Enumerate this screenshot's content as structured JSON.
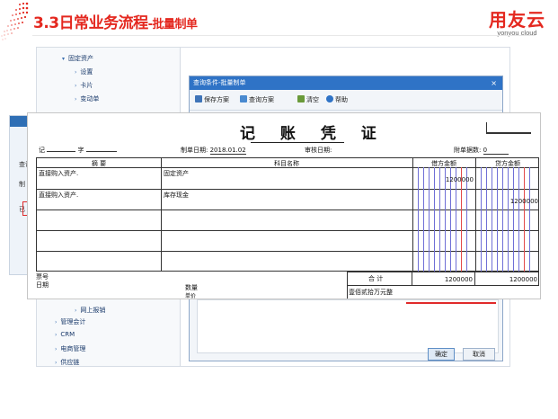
{
  "header": {
    "title_main": "3.3日常业务流程",
    "title_sub": "-批量制单",
    "logo_cn": "用友云",
    "logo_en": "yonyou cloud"
  },
  "nav": {
    "items": [
      {
        "label": "固定资产",
        "arrow": "▾"
      },
      {
        "label": "设置",
        "arrow": "›"
      },
      {
        "label": "卡片",
        "arrow": "›"
      },
      {
        "label": "变动单",
        "arrow": "›"
      },
      {
        "label": "网上报销",
        "arrow": "›"
      },
      {
        "label": "管理会计",
        "arrow": "›"
      },
      {
        "label": "CRM",
        "arrow": "›"
      },
      {
        "label": "电商管理",
        "arrow": "›"
      },
      {
        "label": "供应链",
        "arrow": "›"
      }
    ]
  },
  "left_strip": {
    "t1": "查询",
    "t2": "制",
    "t3": "已"
  },
  "dialog": {
    "title": "查询条件-批量制单",
    "close": "×",
    "toolbar": {
      "save_plan": "保存方案",
      "query_plan": "查询方案",
      "clear": "清空",
      "help": "帮助"
    },
    "ok": "确定",
    "cancel": "取消"
  },
  "voucher": {
    "title": "记 账 凭 证",
    "type_label": "记",
    "no_label": "字",
    "date_label": "制单日期:",
    "date_value": "2018.01.02",
    "audit_label": "审核日期:",
    "attach_label": "附单据数:",
    "attach_value": "0",
    "columns": {
      "summary": "摘  要",
      "account": "科目名称",
      "debit": "借方金额",
      "credit": "贷方金额"
    },
    "rows": [
      {
        "summary": "直接购入资产.",
        "account": "固定资产",
        "debit": "1200000",
        "credit": ""
      },
      {
        "summary": "直接购入资产.",
        "account": "库存现金",
        "debit": "",
        "credit": "1200000"
      },
      {
        "summary": "",
        "account": "",
        "debit": "",
        "credit": ""
      },
      {
        "summary": "",
        "account": "",
        "debit": "",
        "credit": ""
      },
      {
        "summary": "",
        "account": "",
        "debit": "",
        "credit": ""
      }
    ],
    "footer": {
      "bill_no": "票号",
      "date": "日期",
      "qty": "数量",
      "unit": "单价",
      "total_label": "合  计",
      "total_debit": "1200000",
      "total_credit": "1200000",
      "amount_words": "壹佰贰拾万元整"
    }
  }
}
